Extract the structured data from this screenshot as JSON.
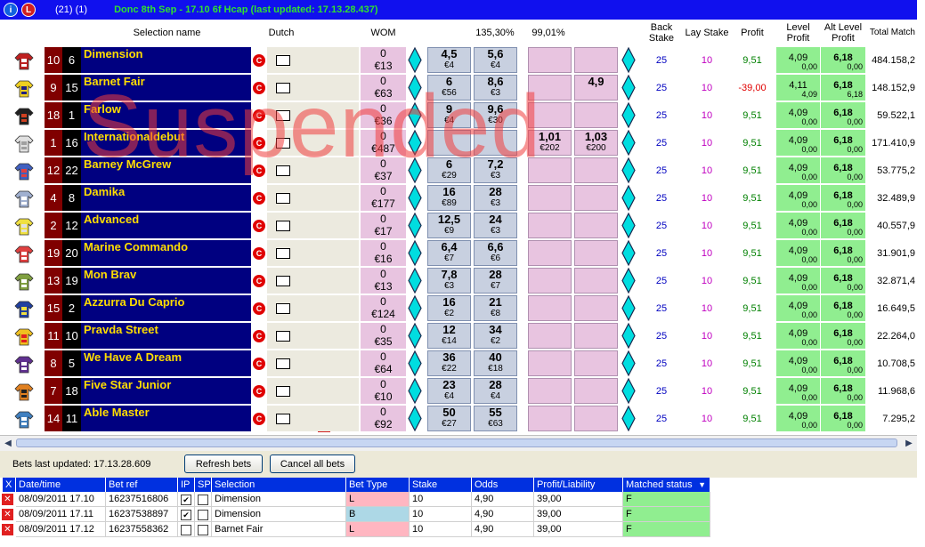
{
  "titlebar": {
    "count": "(21) (1)",
    "market": "Donc 8th Sep - 17.10 6f Hcap (last updated: 17.13.28.437)"
  },
  "headers": {
    "selection_name": "Selection name",
    "dutch": "Dutch",
    "wom": "WOM",
    "back_book": "135,30%",
    "lay_book": "99,01%",
    "back_stake": "Back Stake",
    "lay_stake": "Lay Stake",
    "profit": "Profit",
    "level_profit": "Level Profit",
    "alt_level_profit": "Alt Level Profit",
    "total_matched": "Total Match"
  },
  "overlay": {
    "suspended": "Suspended"
  },
  "runners": [
    {
      "saddle": "10",
      "draw": "6",
      "name": "Dimension",
      "wom_top": "0",
      "wom_amt": "€13",
      "b1": "4,5",
      "b1s": "€4",
      "b2": "5,6",
      "b2s": "€4",
      "l1": "",
      "l1s": "",
      "l2": "",
      "l2s": "",
      "back_stake": "25",
      "lay_stake": "10",
      "profit": "9,51",
      "neg": false,
      "level": "4,09",
      "level_sub": "0,00",
      "alt": "6,18",
      "alt_sub": "0,00",
      "matched": "484.158,2",
      "badge": "",
      "silk": [
        "#c02020",
        "#ffffff"
      ]
    },
    {
      "saddle": "9",
      "draw": "15",
      "name": "Barnet Fair",
      "wom_top": "0",
      "wom_amt": "€63",
      "b1": "6",
      "b1s": "€56",
      "b2": "8,6",
      "b2s": "€3",
      "l1": "",
      "l1s": "",
      "l2": "4,9",
      "l2s": "",
      "back_stake": "25",
      "lay_stake": "10",
      "profit": "-39,00",
      "neg": true,
      "level": "4,11",
      "level_sub": "4,09",
      "alt": "6,18",
      "alt_sub": "6,18",
      "matched": "148.152,9",
      "badge": "",
      "silk": [
        "#f0d020",
        "#202080"
      ]
    },
    {
      "saddle": "18",
      "draw": "1",
      "name": "Farlow",
      "wom_top": "0",
      "wom_amt": "€36",
      "b1": "9",
      "b1s": "€4",
      "b2": "9,6",
      "b2s": "€30",
      "l1": "",
      "l1s": "",
      "l2": "",
      "l2s": "",
      "back_stake": "25",
      "lay_stake": "10",
      "profit": "9,51",
      "neg": false,
      "level": "4,09",
      "level_sub": "0,00",
      "alt": "6,18",
      "alt_sub": "0,00",
      "matched": "59.522,1",
      "badge": "",
      "silk": [
        "#202020",
        "#d04020"
      ]
    },
    {
      "saddle": "1",
      "draw": "16",
      "name": "Internationaldebut",
      "wom_top": "0",
      "wom_amt": "€487",
      "b1": "",
      "b1s": "",
      "b2": "",
      "b2s": "",
      "l1": "1,01",
      "l1s": "€202",
      "l2": "1,03",
      "l2s": "€200",
      "back_stake": "25",
      "lay_stake": "10",
      "profit": "9,51",
      "neg": false,
      "level": "4,09",
      "level_sub": "0,00",
      "alt": "6,18",
      "alt_sub": "0,00",
      "matched": "171.410,9",
      "badge": "1",
      "silk": [
        "#e0e0e0",
        "#a0a0a0"
      ]
    },
    {
      "saddle": "12",
      "draw": "22",
      "name": "Barney McGrew",
      "wom_top": "0",
      "wom_amt": "€37",
      "b1": "6",
      "b1s": "€29",
      "b2": "7,2",
      "b2s": "€3",
      "l1": "",
      "l1s": "",
      "l2": "",
      "l2s": "",
      "back_stake": "25",
      "lay_stake": "10",
      "profit": "9,51",
      "neg": false,
      "level": "4,09",
      "level_sub": "0,00",
      "alt": "6,18",
      "alt_sub": "0,00",
      "matched": "53.775,2",
      "badge": "",
      "silk": [
        "#4060c0",
        "#e04040"
      ]
    },
    {
      "saddle": "4",
      "draw": "8",
      "name": "Damika",
      "wom_top": "0",
      "wom_amt": "€177",
      "b1": "16",
      "b1s": "€89",
      "b2": "28",
      "b2s": "€3",
      "l1": "",
      "l1s": "",
      "l2": "",
      "l2s": "",
      "back_stake": "25",
      "lay_stake": "10",
      "profit": "9,51",
      "neg": false,
      "level": "4,09",
      "level_sub": "0,00",
      "alt": "6,18",
      "alt_sub": "0,00",
      "matched": "32.489,9",
      "badge": "",
      "silk": [
        "#a0b0d0",
        "#ffffff"
      ]
    },
    {
      "saddle": "2",
      "draw": "12",
      "name": "Advanced",
      "wom_top": "0",
      "wom_amt": "€17",
      "b1": "12,5",
      "b1s": "€9",
      "b2": "24",
      "b2s": "€3",
      "l1": "",
      "l1s": "",
      "l2": "",
      "l2s": "",
      "back_stake": "25",
      "lay_stake": "10",
      "profit": "9,51",
      "neg": false,
      "level": "4,09",
      "level_sub": "0,00",
      "alt": "6,18",
      "alt_sub": "0,00",
      "matched": "40.557,9",
      "badge": "",
      "silk": [
        "#f0e040",
        "#e0e0e0"
      ]
    },
    {
      "saddle": "19",
      "draw": "20",
      "name": "Marine Commando",
      "wom_top": "0",
      "wom_amt": "€16",
      "b1": "6,4",
      "b1s": "€7",
      "b2": "6,6",
      "b2s": "€6",
      "l1": "",
      "l1s": "",
      "l2": "",
      "l2s": "",
      "back_stake": "25",
      "lay_stake": "10",
      "profit": "9,51",
      "neg": false,
      "level": "4,09",
      "level_sub": "0,00",
      "alt": "6,18",
      "alt_sub": "0,00",
      "matched": "31.901,9",
      "badge": "",
      "silk": [
        "#e04040",
        "#ffffff"
      ]
    },
    {
      "saddle": "13",
      "draw": "19",
      "name": "Mon Brav",
      "wom_top": "0",
      "wom_amt": "€13",
      "b1": "7,8",
      "b1s": "€3",
      "b2": "28",
      "b2s": "€7",
      "l1": "",
      "l1s": "",
      "l2": "",
      "l2s": "",
      "back_stake": "25",
      "lay_stake": "10",
      "profit": "9,51",
      "neg": false,
      "level": "4,09",
      "level_sub": "0,00",
      "alt": "6,18",
      "alt_sub": "0,00",
      "matched": "32.871,4",
      "badge": "",
      "silk": [
        "#80a040",
        "#ffffff"
      ]
    },
    {
      "saddle": "15",
      "draw": "2",
      "name": "Azzurra Du Caprio",
      "wom_top": "0",
      "wom_amt": "€124",
      "b1": "16",
      "b1s": "€2",
      "b2": "21",
      "b2s": "€8",
      "l1": "",
      "l1s": "",
      "l2": "",
      "l2s": "",
      "back_stake": "25",
      "lay_stake": "10",
      "profit": "9,51",
      "neg": false,
      "level": "4,09",
      "level_sub": "0,00",
      "alt": "6,18",
      "alt_sub": "0,00",
      "matched": "16.649,5",
      "badge": "",
      "silk": [
        "#2040a0",
        "#f0e040"
      ]
    },
    {
      "saddle": "11",
      "draw": "10",
      "name": "Pravda Street",
      "wom_top": "0",
      "wom_amt": "€35",
      "b1": "12",
      "b1s": "€14",
      "b2": "34",
      "b2s": "€2",
      "l1": "",
      "l1s": "",
      "l2": "",
      "l2s": "",
      "back_stake": "25",
      "lay_stake": "10",
      "profit": "9,51",
      "neg": false,
      "level": "4,09",
      "level_sub": "0,00",
      "alt": "6,18",
      "alt_sub": "0,00",
      "matched": "22.264,0",
      "badge": "",
      "silk": [
        "#f0c020",
        "#e02020"
      ]
    },
    {
      "saddle": "8",
      "draw": "5",
      "name": "We Have A Dream",
      "wom_top": "0",
      "wom_amt": "€64",
      "b1": "36",
      "b1s": "€22",
      "b2": "40",
      "b2s": "€18",
      "l1": "",
      "l1s": "",
      "l2": "",
      "l2s": "",
      "back_stake": "25",
      "lay_stake": "10",
      "profit": "9,51",
      "neg": false,
      "level": "4,09",
      "level_sub": "0,00",
      "alt": "6,18",
      "alt_sub": "0,00",
      "matched": "10.708,5",
      "badge": "",
      "silk": [
        "#603090",
        "#ffffff"
      ]
    },
    {
      "saddle": "7",
      "draw": "18",
      "name": "Five Star Junior",
      "wom_top": "0",
      "wom_amt": "€10",
      "b1": "23",
      "b1s": "€4",
      "b2": "28",
      "b2s": "€4",
      "l1": "",
      "l1s": "",
      "l2": "",
      "l2s": "",
      "back_stake": "25",
      "lay_stake": "10",
      "profit": "9,51",
      "neg": false,
      "level": "4,09",
      "level_sub": "0,00",
      "alt": "6,18",
      "alt_sub": "0,00",
      "matched": "11.968,6",
      "badge": "",
      "silk": [
        "#e08020",
        "#202020"
      ]
    },
    {
      "saddle": "14",
      "draw": "11",
      "name": "Able Master",
      "wom_top": "0",
      "wom_amt": "€92",
      "b1": "50",
      "b1s": "€27",
      "b2": "55",
      "b2s": "€63",
      "l1": "",
      "l1s": "",
      "l2": "",
      "l2s": "",
      "back_stake": "25",
      "lay_stake": "10",
      "profit": "9,51",
      "neg": false,
      "level": "4,09",
      "level_sub": "0,00",
      "alt": "6,18",
      "alt_sub": "0,00",
      "matched": "7.295,2",
      "badge": "",
      "silk": [
        "#4080c0",
        "#ffffff"
      ]
    }
  ],
  "bets_bar": {
    "last_updated": "Bets last updated: 17.13.28.609",
    "refresh": "Refresh bets",
    "cancel_all": "Cancel all bets"
  },
  "bets_table": {
    "headers": [
      "X",
      "Date/time",
      "Bet ref",
      "IP",
      "SP",
      "Selection",
      "Bet Type",
      "Stake",
      "Odds",
      "Profit/Liability",
      "Matched status"
    ],
    "rows": [
      {
        "datetime": "08/09/2011 17.10",
        "ref": "16237516806",
        "ip": true,
        "sp": false,
        "selection": "Dimension",
        "type": "L",
        "stake": "10",
        "odds": "4,90",
        "pl": "39,00",
        "status": "F"
      },
      {
        "datetime": "08/09/2011 17.11",
        "ref": "16237538897",
        "ip": true,
        "sp": false,
        "selection": "Dimension",
        "type": "B",
        "stake": "10",
        "odds": "4,90",
        "pl": "39,00",
        "status": "F"
      },
      {
        "datetime": "08/09/2011 17.12",
        "ref": "16237558362",
        "ip": false,
        "sp": false,
        "selection": "Barnet Fair",
        "type": "L",
        "stake": "10",
        "odds": "4,90",
        "pl": "39,00",
        "status": "F"
      }
    ]
  },
  "colors": {
    "titlebar": "#1010ee",
    "selection_bg": "#000080",
    "selection_text": "#ffdd00",
    "wom_bg": "#e8c4e0",
    "back_bg": "#c8d0e0",
    "profit_green": "#008000",
    "loss_red": "#e00000",
    "level_bg": "#90ee90"
  }
}
